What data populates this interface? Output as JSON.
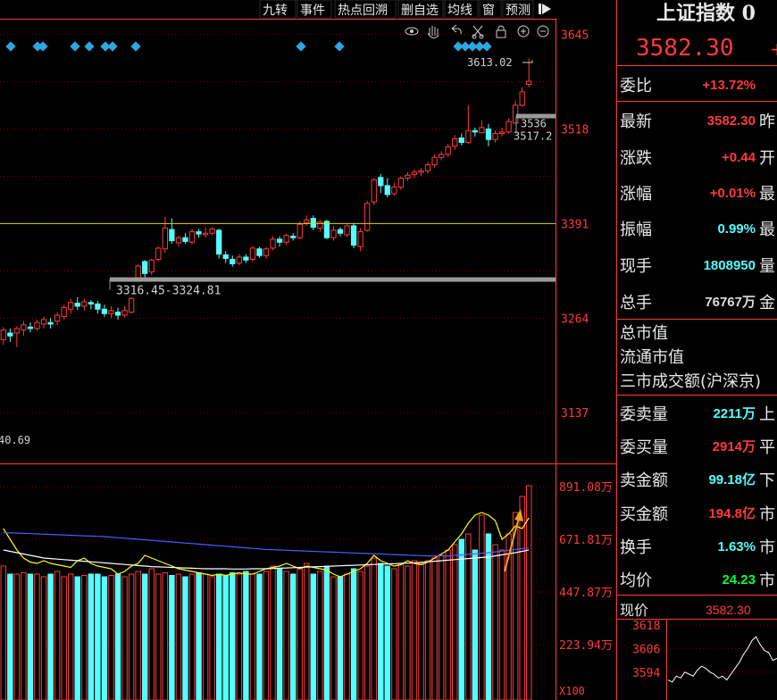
{
  "toolbar": {
    "tabs": [
      "九转",
      "事件",
      "热点回溯",
      "删自选",
      "均线",
      "窗",
      "预测"
    ],
    "icons": [
      "eye-icon",
      "hand-icon",
      "undo-icon",
      "scissors-icon",
      "lock-icon",
      "zoom-in-icon",
      "zoom-out-icon"
    ]
  },
  "chart_data": [
    {
      "type": "candlestick",
      "price_axis_ticks": [
        "3645",
        "3518",
        "3391",
        "3264",
        "3137"
      ],
      "ylim": [
        3070,
        3665
      ],
      "up_color": "#ff3a3a",
      "down_color": "#54ffff",
      "reference_line": 3391,
      "annotations": {
        "high_label": "3613.02",
        "right_label_1": "3536",
        "right_label_2": "3517.2",
        "support_label": "3316.45-3324.81",
        "low_label": "40.69"
      },
      "support_range": [
        3316.45,
        3324.81
      ],
      "resistance_range": [
        3517.2,
        3536
      ],
      "candles": [
        [
          3235,
          3248,
          3252,
          3228,
          1
        ],
        [
          3240,
          3244,
          3250,
          3232,
          0
        ],
        [
          3244,
          3250,
          3253,
          3225,
          1
        ],
        [
          3248,
          3255,
          3260,
          3240,
          1
        ],
        [
          3252,
          3250,
          3258,
          3245,
          0
        ],
        [
          3250,
          3258,
          3262,
          3247,
          1
        ],
        [
          3256,
          3262,
          3266,
          3250,
          1
        ],
        [
          3258,
          3256,
          3264,
          3250,
          0
        ],
        [
          3260,
          3268,
          3272,
          3255,
          1
        ],
        [
          3266,
          3278,
          3282,
          3262,
          1
        ],
        [
          3276,
          3285,
          3290,
          3270,
          1
        ],
        [
          3284,
          3280,
          3292,
          3275,
          0
        ],
        [
          3280,
          3286,
          3290,
          3274,
          1
        ],
        [
          3285,
          3283,
          3288,
          3276,
          0
        ],
        [
          3283,
          3276,
          3287,
          3270,
          0
        ],
        [
          3276,
          3270,
          3282,
          3266,
          0
        ],
        [
          3270,
          3274,
          3280,
          3264,
          1
        ],
        [
          3272,
          3268,
          3278,
          3262,
          0
        ],
        [
          3268,
          3274,
          3280,
          3265,
          1
        ],
        [
          3272,
          3290,
          3292,
          3270,
          1
        ],
        [
          3316,
          3334,
          3336,
          3314,
          1
        ],
        [
          3340,
          3324,
          3342,
          3318,
          0
        ],
        [
          3326,
          3342,
          3344,
          3322,
          1
        ],
        [
          3343,
          3358,
          3360,
          3340,
          1
        ],
        [
          3357,
          3385,
          3400,
          3352,
          1
        ],
        [
          3383,
          3368,
          3398,
          3364,
          0
        ],
        [
          3365,
          3372,
          3375,
          3360,
          1
        ],
        [
          3372,
          3367,
          3378,
          3364,
          0
        ],
        [
          3366,
          3380,
          3384,
          3363,
          1
        ],
        [
          3380,
          3377,
          3384,
          3372,
          0
        ],
        [
          3376,
          3378,
          3386,
          3372,
          1
        ],
        [
          3378,
          3384,
          3386,
          3375,
          1
        ],
        [
          3382,
          3350,
          3384,
          3344,
          0
        ],
        [
          3349,
          3344,
          3354,
          3338,
          0
        ],
        [
          3343,
          3337,
          3348,
          3333,
          0
        ],
        [
          3338,
          3346,
          3350,
          3335,
          1
        ],
        [
          3346,
          3342,
          3350,
          3338,
          0
        ],
        [
          3343,
          3358,
          3361,
          3340,
          1
        ],
        [
          3357,
          3348,
          3360,
          3345,
          0
        ],
        [
          3348,
          3357,
          3360,
          3344,
          1
        ],
        [
          3358,
          3370,
          3374,
          3355,
          1
        ],
        [
          3370,
          3366,
          3374,
          3360,
          0
        ],
        [
          3366,
          3375,
          3378,
          3362,
          1
        ],
        [
          3374,
          3372,
          3378,
          3368,
          0
        ],
        [
          3372,
          3390,
          3394,
          3370,
          1
        ],
        [
          3392,
          3396,
          3402,
          3388,
          1
        ],
        [
          3398,
          3386,
          3402,
          3382,
          0
        ],
        [
          3385,
          3393,
          3396,
          3380,
          1
        ],
        [
          3394,
          3372,
          3396,
          3370,
          0
        ],
        [
          3372,
          3382,
          3388,
          3368,
          1
        ],
        [
          3383,
          3378,
          3386,
          3374,
          0
        ],
        [
          3376,
          3388,
          3390,
          3373,
          1
        ],
        [
          3388,
          3362,
          3392,
          3358,
          0
        ],
        [
          3360,
          3380,
          3385,
          3354,
          1
        ],
        [
          3382,
          3418,
          3422,
          3380,
          1
        ],
        [
          3420,
          3450,
          3452,
          3416,
          1
        ],
        [
          3453,
          3442,
          3458,
          3432,
          0
        ],
        [
          3442,
          3430,
          3452,
          3426,
          0
        ],
        [
          3431,
          3440,
          3446,
          3428,
          1
        ],
        [
          3440,
          3452,
          3454,
          3436,
          1
        ],
        [
          3452,
          3456,
          3460,
          3448,
          1
        ],
        [
          3457,
          3460,
          3464,
          3452,
          1
        ],
        [
          3460,
          3462,
          3466,
          3455,
          1
        ],
        [
          3462,
          3470,
          3474,
          3458,
          1
        ],
        [
          3470,
          3480,
          3484,
          3466,
          1
        ],
        [
          3480,
          3484,
          3488,
          3476,
          1
        ],
        [
          3484,
          3494,
          3498,
          3480,
          1
        ],
        [
          3495,
          3505,
          3510,
          3490,
          1
        ],
        [
          3506,
          3500,
          3512,
          3496,
          0
        ],
        [
          3500,
          3516,
          3550,
          3498,
          1
        ],
        [
          3516,
          3514,
          3520,
          3508,
          0
        ],
        [
          3513,
          3520,
          3530,
          3512,
          1
        ],
        [
          3518,
          3504,
          3525,
          3495,
          0
        ],
        [
          3504,
          3512,
          3516,
          3500,
          1
        ],
        [
          3512,
          3514,
          3520,
          3508,
          1
        ],
        [
          3514,
          3528,
          3532,
          3512,
          1
        ],
        [
          3526,
          3550,
          3556,
          3525,
          1
        ],
        [
          3550,
          3568,
          3574,
          3548,
          1
        ],
        [
          3578,
          3582.3,
          3613.02,
          3574,
          1
        ]
      ]
    },
    {
      "type": "bar",
      "title": "volume",
      "ylim": [
        0,
        1000
      ],
      "y_axis_ticks": [
        "891.08万",
        "671.81万",
        "447.87万",
        "223.94万"
      ],
      "unit_label": "X100",
      "values": [
        500,
        470,
        470,
        475,
        470,
        470,
        460,
        470,
        480,
        460,
        470,
        460,
        465,
        470,
        470,
        460,
        465,
        470,
        460,
        470,
        480,
        470,
        490,
        470,
        475,
        465,
        470,
        460,
        470,
        475,
        470,
        460,
        470,
        465,
        475,
        470,
        480,
        470,
        470,
        480,
        500,
        490,
        480,
        470,
        490,
        510,
        470,
        480,
        500,
        460,
        460,
        470,
        490,
        480,
        500,
        530,
        510,
        500,
        490,
        510,
        500,
        520,
        510,
        520,
        530,
        540,
        560,
        580,
        600,
        620,
        560,
        690,
        620,
        580,
        560,
        620,
        700,
        760,
        800
      ],
      "ma_series": [
        {
          "color": "#ffff00",
          "values": [
            640,
            600,
            560,
            530,
            515,
            510,
            520,
            510,
            505,
            500,
            495,
            520,
            530,
            510,
            500,
            495,
            490,
            470,
            480,
            500,
            510,
            540,
            530,
            520,
            510,
            500,
            490,
            485,
            480,
            475,
            470,
            465,
            470,
            465,
            470,
            475,
            470,
            470,
            480,
            490,
            495,
            500,
            510,
            500,
            490,
            500,
            495,
            490,
            485,
            470,
            460,
            470,
            480,
            490,
            510,
            540,
            520,
            510,
            500,
            505,
            520,
            510,
            505,
            515,
            530,
            545,
            560,
            590,
            620,
            660,
            690,
            700,
            690,
            670,
            600,
            620,
            650,
            640,
            680
          ]
        },
        {
          "color": "#ffffff",
          "values": [
            560,
            555,
            550,
            545,
            540,
            535,
            530,
            528,
            526,
            524,
            522,
            520,
            518,
            516,
            514,
            512,
            510,
            508,
            506,
            504,
            502,
            500,
            498,
            497,
            496,
            495,
            494,
            493,
            492,
            491,
            490,
            490,
            490,
            490,
            489,
            489,
            489,
            490,
            490,
            490,
            491,
            492,
            493,
            494,
            495,
            496,
            497,
            498,
            499,
            500,
            501,
            502,
            503,
            504,
            505,
            506,
            507,
            508,
            509,
            510,
            511,
            512,
            514,
            516,
            518,
            520,
            522,
            524,
            526,
            528,
            530,
            532,
            534,
            538,
            542,
            546,
            550,
            555,
            560
          ]
        },
        {
          "color": "#4f5bff",
          "values": [
            625,
            624,
            623,
            622,
            621,
            620,
            619,
            618,
            617,
            616,
            615,
            614,
            613,
            612,
            611,
            610,
            608,
            606,
            604,
            602,
            600,
            598,
            596,
            594,
            592,
            590,
            588,
            586,
            584,
            582,
            580,
            578,
            576,
            574,
            572,
            570,
            568,
            566,
            564,
            562,
            561,
            560,
            559,
            558,
            557,
            556,
            555,
            554,
            553,
            552,
            551,
            550,
            549,
            548,
            547,
            546,
            545,
            544,
            543,
            542,
            541,
            540,
            539,
            538,
            538,
            538,
            538,
            540,
            542,
            544,
            546,
            548,
            550,
            553,
            556,
            559,
            562,
            565,
            568
          ]
        }
      ]
    },
    {
      "type": "line",
      "title": "minute",
      "current_price_label": "现价",
      "current_price": "3582.30",
      "y_axis_ticks": [
        "3618",
        "3606",
        "3594"
      ],
      "ylim": [
        3588,
        3618
      ],
      "values": [
        3590,
        3589,
        3592,
        3591,
        3594,
        3593,
        3592,
        3595,
        3597,
        3596,
        3594,
        3593,
        3591,
        3592,
        3590,
        3593,
        3596,
        3599,
        3603,
        3606,
        3610,
        3612,
        3608,
        3605,
        3604,
        3600,
        3601
      ]
    }
  ],
  "quote_panel": {
    "title": "上证指数 0",
    "price": "3582.30",
    "price_suffix": "+",
    "rows": [
      {
        "label": "委比",
        "value": "+13.72%",
        "color": "#ff3a3a",
        "side": ""
      },
      {
        "label": "最新",
        "value": "3582.30",
        "color": "#ff3a3a",
        "side": "昨"
      },
      {
        "label": "涨跌",
        "value": "+0.44",
        "color": "#ff3a3a",
        "side": "开"
      },
      {
        "label": "涨幅",
        "value": "+0.01%",
        "color": "#ff3a3a",
        "side": "最"
      },
      {
        "label": "振幅",
        "value": "0.99%",
        "color": "#54ffff",
        "side": "最"
      },
      {
        "label": "现手",
        "value": "1808950",
        "color": "#54ffff",
        "side": "量"
      },
      {
        "label": "总手",
        "value": "76767万",
        "color": "#dddddd",
        "side": "金"
      }
    ],
    "plain_rows": [
      "总市值",
      "流通市值",
      "三市成交额(沪深京)"
    ],
    "rows2": [
      {
        "label": "委卖量",
        "value": "2211万",
        "color": "#54ffff",
        "side": "上"
      },
      {
        "label": "委买量",
        "value": "2914万",
        "color": "#ff3a3a",
        "side": "平"
      },
      {
        "label": "卖金额",
        "value": "99.18亿",
        "color": "#54ffff",
        "side": "下"
      },
      {
        "label": "买金额",
        "value": "194.8亿",
        "color": "#ff3a3a",
        "side": "市"
      },
      {
        "label": "换手",
        "value": "1.63%",
        "color": "#54ffff",
        "side": "市"
      },
      {
        "label": "均价",
        "value": "24.23",
        "color": "#00ff44",
        "side": "市"
      }
    ]
  }
}
